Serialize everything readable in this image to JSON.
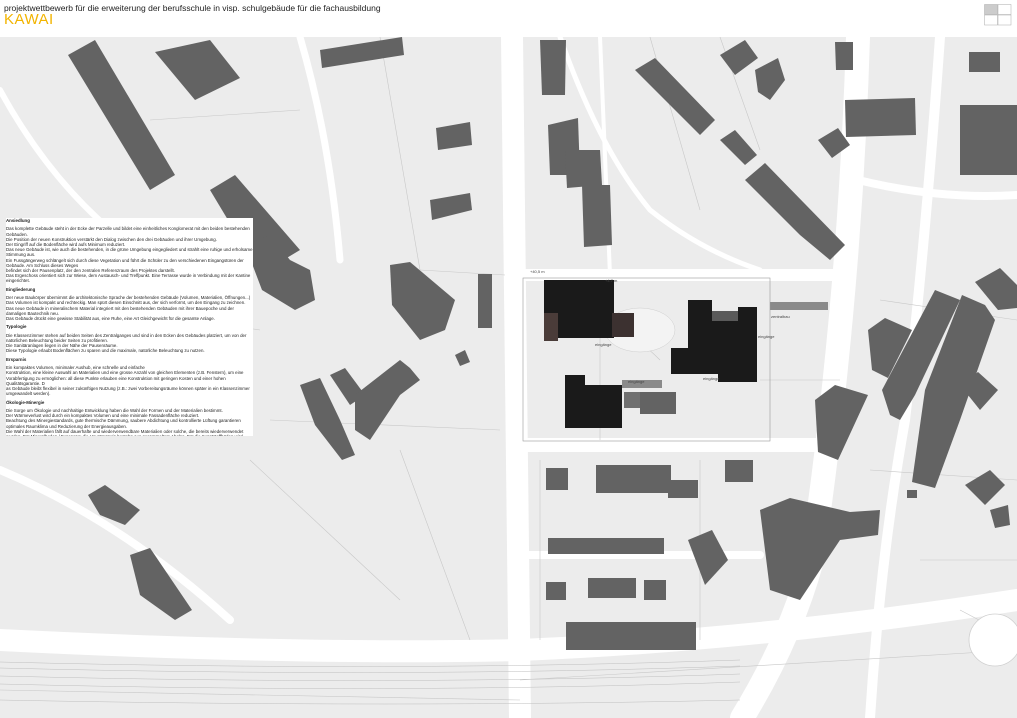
{
  "header": {
    "subtitle": "projektwettbewerb für die erweiterung der berufsschule in visp. schulgebäude für die fachausbildung",
    "title": "KAWAI",
    "accent_color": "#f2b400"
  },
  "sheet_key": {
    "cells": 4,
    "highlight_color": "#cccccc"
  },
  "site_labels": {
    "zentralbau": "zentralbau",
    "eingang_a": "eingänge",
    "eingang_b": "eingänge",
    "eingang_c": "eingänge",
    "eingang_d": "eingänge",
    "erweiterung": "erweiterung",
    "height_a": "+40,5 m",
    "height_b": "+4.7 m"
  },
  "map_colors": {
    "building": "#636363",
    "new_building": "#1a1a1a",
    "existing_on_site": "#3c3130",
    "ground": "#ececec",
    "road": "#ffffff"
  },
  "description": {
    "sections": [
      {
        "heading": "Ansiedlung",
        "lines": [
          "Das komplette Gebäude steht in der Ecke der Parzelle und bildet eine einheitliches Konglomerat mit den beiden bestehenden Gebäuden.",
          "Die Position der neuen Konstruktion verstärkt den Dialog zwischen den drei Gebäuden und ihrer Umgebung.",
          "Der Eingriff auf die Bodenfläche wird aufs Minimum reduziert.",
          "Das neue Gebäude ist, wie auch die bestehenden, in die grüne Umgebung eingegliedert und strahlt eine ruhige und erholsame Stimmung aus.",
          "Ein Fussgängerweg schlängelt sich durch diese Vegetation und führt die Schüler zu den verschiedenen Eingangstüren der Gebäude. Am Schluss dieses Weges",
          "befindet sich der Pausenplatz, der den zentralen Referenzraum des Projektes darstellt.",
          "Das Ergeschoss orientiert sich zur Wiese, dem Austausch- und Treffpunkt. Eine Terrasse wurde in Verbindung mit der Kantine eingerichtet."
        ]
      },
      {
        "heading": "Eingliederung",
        "lines": [
          "Der neue Baukörper übernimmt die architektonische Sprache der bestehenden Gebäude (Volumen, Materialien, Öffnungen...)",
          "Das Volumen ist kompakt und rechteckig. Man spürt diesen Einschnitt aus, der sich verformt, um den Eingang zu zeichnen.",
          "Das neue Gebäude in mineralischem Material integriert mit den bestehenden Gebäuden mit ihrer Bauepoche und der damaligen Bautechnik neu.",
          "Das Gebäude drückt eine gewisse Stabilität aus, eine Ruhe, eine Art Gleichgewicht für die gesamte Anlage."
        ]
      },
      {
        "heading": "Typologie",
        "lines": [
          "Die Klassenzimmer stehen auf beiden Seiten des Zentralganges und sind in den Ecken des Gebäudes platziert, um von der natürlichen Beleuchtung beider Seiten zu profitieren.",
          "Die Sanitäranlagen liegen in der Nähe der Pausenräume.",
          "Diese Typologie erlaubt Bodenflächen zu sparen und die maximale, natürliche Beleuchtung zu nutzen."
        ]
      },
      {
        "heading": "Ersparnis",
        "lines": [
          "Ein kompaktes Volumen, minimaler Aushub, eine schnelle und einfache",
          "Konstruktion, eine kleine Auswahl an Materialien und eine grosse Anzahl von gleichen Elementen (z.B. Fenstern), um eine Vorabfertigung zu ermöglichen: all diese Punkte erlauben eine Konstruktion mit geringen Kosten und einer hohen Qualitätsgarantie. D",
          "as Gebäude bleibt flexibel in seiner zukünftigen Nutzung (z.B.: zwei Vorbereitungsräume können später in ein Klassenzimmer umgewandelt werden)."
        ]
      },
      {
        "heading": "Ökologie-Minergie",
        "lines": [
          "Die Sorge um Ökologie und nachhaltige Entwicklung haben die Wahl der Formen und der Materialien bestimmt.",
          "Der Wärmeverlust wird durch ein kompaktes Volumen und eine minimale Fassadenfläche reduziert.",
          "Beachtung des Minergiestandards, gute thermische Dämmung, saubere Abdichtung und kontrollierte Lüftung garantieren optimales Raumklima und Reduzierung der Energieausgaben.",
          "Die Wahl der Materialien fällt auf dauerhafte und wiederverwendbare Materialien oder solche, die bereits wiederverwendet wurden. Für Mineralboden / Fusengas: die Hauptmateria bestehn aus gesammeltem Abglas. Für die Kunststoffböden wird gebrauchter K",
          "autschuk verwendet."
        ]
      }
    ]
  }
}
